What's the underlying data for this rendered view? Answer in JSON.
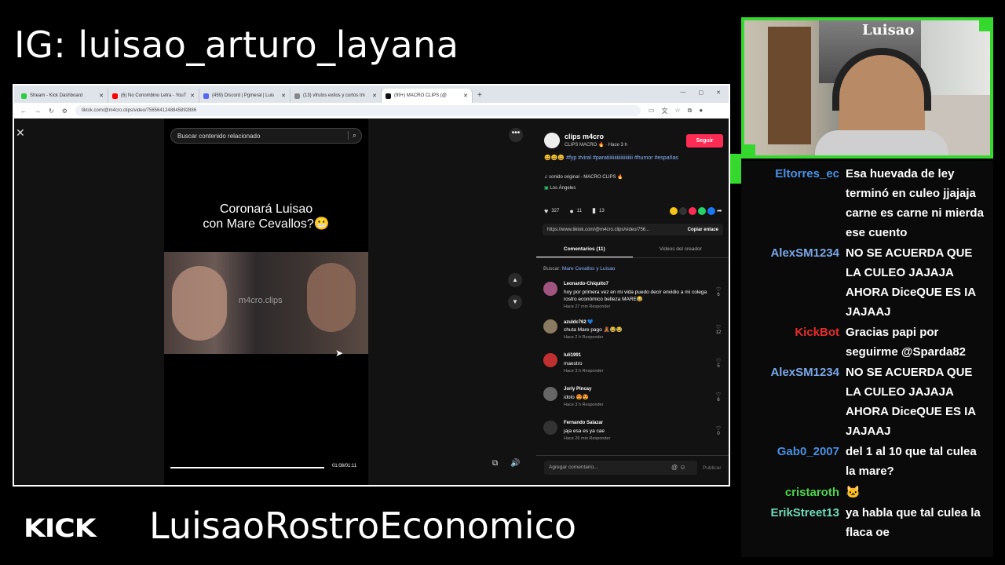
{
  "overlay": {
    "ig_handle": "IG: luisao_arturo_layana",
    "kick_logo": "KICK",
    "channel_name": "LuisaoRostroEconomico"
  },
  "browser": {
    "tabs": [
      {
        "label": "Stream - Kick Dashboard",
        "color": "#2ecc40"
      },
      {
        "label": "(6) No Conombino Letra - YouT",
        "color": "#ff0000"
      },
      {
        "label": "(459) Discord | Pgmeral | Luis",
        "color": "#5865f2"
      },
      {
        "label": "(13) vfrutos exitos y cortos tm",
        "color": "#888888"
      },
      {
        "label": "(99+) MACRO CLIPS (@",
        "color": "#111111"
      }
    ],
    "new_tab": "+",
    "url": "tiktok.com/@m4cro.clips/video/7565641248845892886"
  },
  "tiktok": {
    "search_placeholder": "Buscar contenido relacionado",
    "video_title_line1": "Coronará Luisao",
    "video_title_line2": "con Mare Cevallos?😬",
    "watermark": "m4cro.clips",
    "time": "01:08/01:11",
    "author": "clips m4cro",
    "author_sub": "CLIPS MACRO 🔥 · Hace 3 h",
    "follow_label": "Seguir",
    "caption": "😄😄😄 #fyp #viral #paratiiiiiiiiiiiiiiiiiiii #humor #españas",
    "sound": "♫ sonido original - MACRO CLIPS 🔥",
    "location": "Los Ángeles",
    "likes": "327",
    "comments_count": "11",
    "saves": "13",
    "link": "https://www.tiktok.com/@m4cro.clips/video/756...",
    "copy_link": "Copiar enlace",
    "tab_comments": "Comentarios (11)",
    "tab_creator": "Videos del creador",
    "search_label": "Buscar:",
    "search_term": "Mare Cevallos y Luisao",
    "comments": [
      {
        "user": "Leonardo-Chiquito7",
        "text": "hoy por primera vez en mi vida puedo decir envidio a mi colega rostro económico belleza MARE😂",
        "meta": "Hace 27 min   Responder",
        "likes": "6"
      },
      {
        "user": "azuldc762 💙",
        "text": "chuta Mare pago 🧸😂😂",
        "meta": "Hace 2 h   Responder",
        "likes": "12"
      },
      {
        "user": "luli1991",
        "text": "maestro",
        "meta": "Hace 3 h   Responder",
        "likes": "5"
      },
      {
        "user": "Jorly Pincay",
        "text": "idolo 😍😍",
        "meta": "Hace 3 h   Responder",
        "likes": "6"
      },
      {
        "user": "Fernando Salazar",
        "text": "jaja esa es ya cae",
        "meta": "Hace 26 min   Responder",
        "likes": "0"
      }
    ],
    "add_comment": "Agregar comentario...",
    "publish": "Publicar"
  },
  "webcam": {
    "poster_text": "Luisao"
  },
  "chat": [
    {
      "user": "Eltorres_ec",
      "color": "#4a90e2",
      "text": "Esa huevada de ley terminó en culeo jjajaja carne es carne ni mierda ese cuento"
    },
    {
      "user": "AlexSM1234",
      "color": "#7aa7e8",
      "text": "NO SE ACUERDA QUE LA CULEO JAJAJA AHORA DiceQUE ES IA JAJAAJ"
    },
    {
      "user": "KickBot",
      "color": "#e52d2d",
      "text": "Gracias papi por seguirme @Sparda82"
    },
    {
      "user": "AlexSM1234",
      "color": "#7aa7e8",
      "text": "NO SE ACUERDA QUE LA CULEO JAJAJA AHORA DiceQUE ES IA JAJAAJ"
    },
    {
      "user": "Gab0_2007",
      "color": "#4a90e2",
      "text": "del 1 al 10 que tal culea la mare?"
    },
    {
      "user": "cristaroth",
      "color": "#4fd44f",
      "text": "🐱"
    },
    {
      "user": "ErikStreet13",
      "color": "#6fd9b8",
      "text": "ya habla que tal culea la flaca oe"
    }
  ]
}
